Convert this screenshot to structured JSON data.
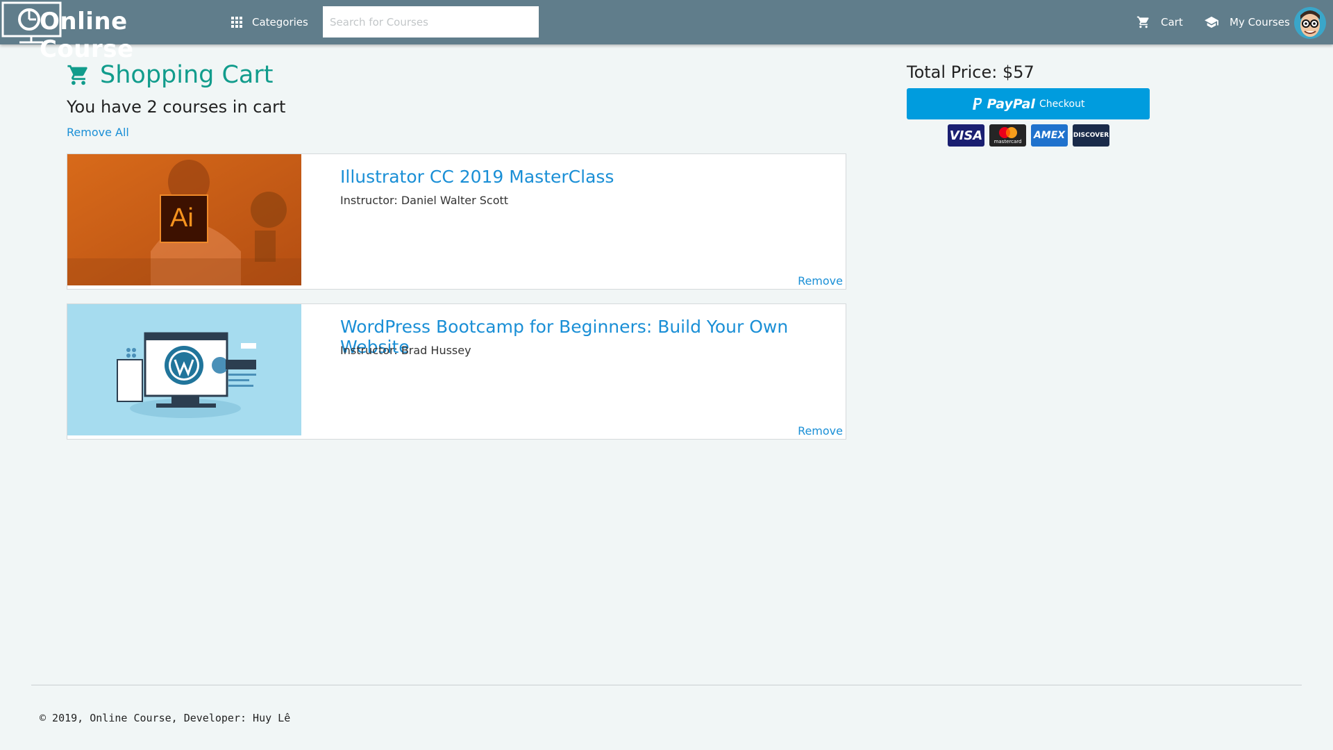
{
  "header": {
    "logo_text": "Online Course",
    "categories_label": "Categories",
    "search_placeholder": "Search for Courses",
    "cart_label": "Cart",
    "my_courses_label": "My Courses"
  },
  "cart": {
    "title": "Shopping Cart",
    "count_text": "You have 2 courses in cart",
    "remove_all_label": "Remove All",
    "courses": [
      {
        "title": "Illustrator CC 2019 MasterClass",
        "instructor": "Instructor: Daniel Walter Scott",
        "thumbnail_badge": "Ai",
        "remove_label": "Remove"
      },
      {
        "title": "WordPress Bootcamp for Beginners: Build Your Own Website",
        "instructor": "Instructor: Brad Hussey",
        "remove_label": "Remove"
      }
    ]
  },
  "checkout": {
    "total_price": "Total Price: $57",
    "paypal_brand": "PayPal",
    "paypal_label": "Checkout",
    "payment_cards": [
      "VISA",
      "mastercard",
      "AMEX",
      "DISCOVER"
    ]
  },
  "footer": {
    "text": "© 2019, Online Course, Developer: Huy Lê"
  },
  "colors": {
    "navbar": "#607d8b",
    "accent_teal": "#119c8c",
    "link_blue": "#1a8fd6",
    "paypal_blue": "#009cde",
    "page_bg": "#f1f6f6"
  }
}
